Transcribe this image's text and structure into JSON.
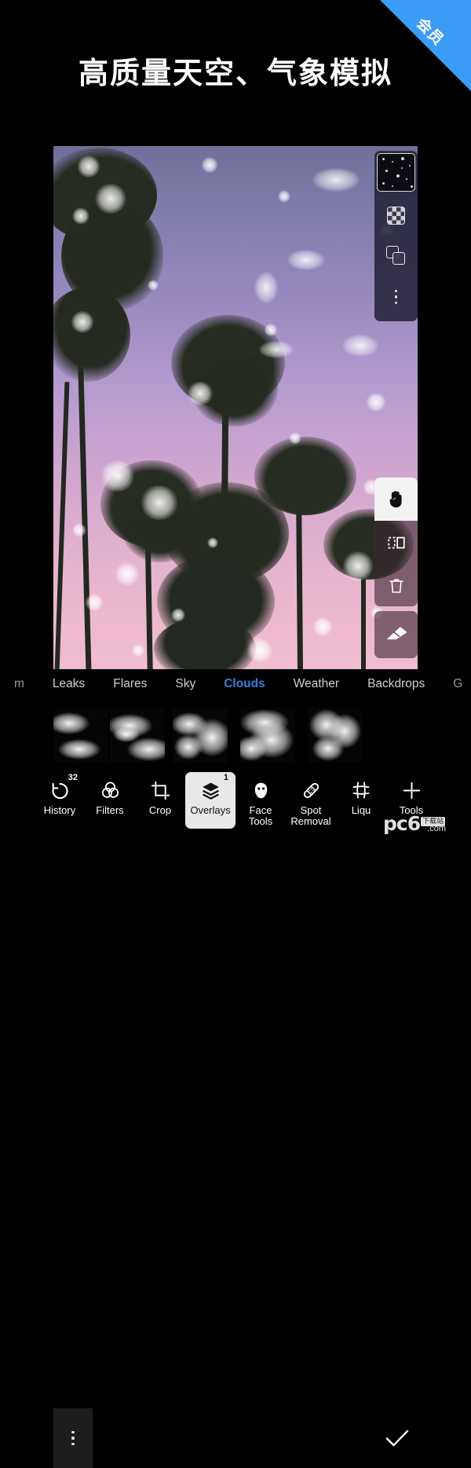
{
  "promo": {
    "title": "高质量天空、气象模拟",
    "ribbon_label": "会员",
    "ribbon_color": "#3a9bf4"
  },
  "canvas": {
    "description": "purple-to-pink gradient sunset sky with palm tree silhouettes and white cloud overlay",
    "sky_top_color": "#6f7099",
    "sky_mid_color": "#b49bd0",
    "sky_bottom_color": "#efbcd0",
    "palm_color": "#262c21"
  },
  "layer_panel": {
    "thumbnail_name": "overlay-thumbnail",
    "buttons": [
      {
        "name": "mask-button",
        "icon": "checkerboard-icon"
      },
      {
        "name": "duplicate-layer-button",
        "icon": "duplicate-icon"
      },
      {
        "name": "layer-more-button",
        "icon": "more-vertical-icon"
      }
    ]
  },
  "tool_panel": {
    "buttons": [
      {
        "name": "pan-tool-button",
        "icon": "hand-icon",
        "active": true
      },
      {
        "name": "flip-button",
        "icon": "flip-horizontal-icon",
        "active": false
      },
      {
        "name": "delete-button",
        "icon": "trash-icon",
        "active": false
      }
    ],
    "eraser": {
      "name": "eraser-button",
      "icon": "eraser-icon"
    }
  },
  "category_tabs": {
    "items": [
      {
        "label": "m",
        "active": false,
        "clipped": true
      },
      {
        "label": "Leaks",
        "active": false,
        "clipped": false
      },
      {
        "label": "Flares",
        "active": false,
        "clipped": false
      },
      {
        "label": "Sky",
        "active": false,
        "clipped": false
      },
      {
        "label": "Clouds",
        "active": true,
        "clipped": false
      },
      {
        "label": "Weather",
        "active": false,
        "clipped": false
      },
      {
        "label": "Backdrops",
        "active": false,
        "clipped": false
      },
      {
        "label": "G",
        "active": false,
        "clipped": true
      }
    ],
    "active_color": "#3b7bd8"
  },
  "thumb_strip": {
    "menu_icon": "more-vertical-icon",
    "confirm_icon": "check-icon",
    "items": [
      {
        "name": "cloud-thumbnail-1"
      },
      {
        "name": "cloud-thumbnail-2"
      },
      {
        "name": "cloud-thumbnail-3"
      },
      {
        "name": "cloud-thumbnail-4"
      },
      {
        "name": "cloud-thumbnail-5"
      },
      {
        "name": "cloud-thumbnail-6"
      }
    ]
  },
  "bottom_toolbar": {
    "items": [
      {
        "label": "History",
        "icon": "undo-history-icon",
        "badge": "32",
        "selected": false
      },
      {
        "label": "Filters",
        "icon": "filters-circles-icon",
        "badge": "",
        "selected": false
      },
      {
        "label": "Crop",
        "icon": "crop-icon",
        "badge": "",
        "selected": false
      },
      {
        "label": "Overlays",
        "icon": "layers-icon",
        "badge": "1",
        "selected": true
      },
      {
        "label": "Face\nTools",
        "icon": "face-icon",
        "badge": "",
        "selected": false
      },
      {
        "label": "Spot\nRemoval",
        "icon": "bandage-icon",
        "badge": "",
        "selected": false
      },
      {
        "label": "Liqu",
        "icon": "liquify-mesh-icon",
        "badge": "",
        "selected": false
      },
      {
        "label": "Tools",
        "icon": "plus-icon",
        "badge": "",
        "selected": false
      }
    ],
    "selected_bg": "#e8e8e8"
  },
  "watermark": {
    "text": "pc6",
    "box_text": "下载站",
    "com_text": ".com"
  }
}
